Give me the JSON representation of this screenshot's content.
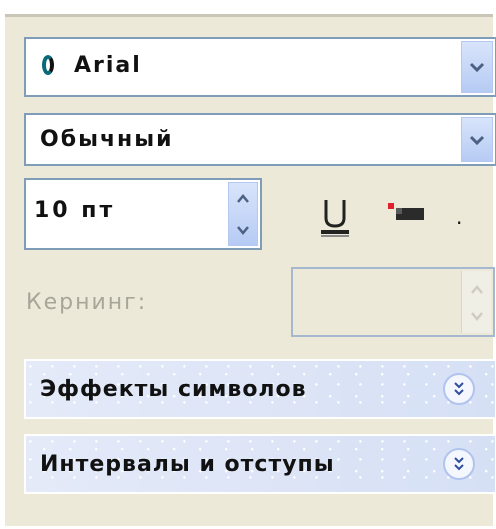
{
  "window": {
    "title_fragment": "...."
  },
  "font": {
    "family_label": "Arial",
    "style_label": "Обычный",
    "size_value": "10 пт"
  },
  "kerning": {
    "label": "Кернинг:",
    "value": ""
  },
  "sections": {
    "effects_label": "Эффекты символов",
    "spacing_label": "Интервалы и отступы"
  },
  "icons": {
    "font_dropdown": "chevron-down-icon",
    "style_dropdown": "chevron-down-icon",
    "size_up": "triangle-up-icon",
    "size_down": "triangle-down-icon",
    "underline": "underline-icon",
    "text_color": "text-color-icon",
    "section_expand": "double-chevron-icon"
  },
  "colors": {
    "panel_bg": "#ece9d8",
    "field_border": "#7f9db9",
    "button_blue": "#b6cbf4",
    "section_bg": "#d6e0f5",
    "disabled_text": "#a7a699",
    "color_swatch_red": "#e0202a"
  }
}
